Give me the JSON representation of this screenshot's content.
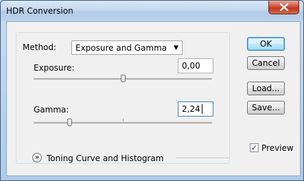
{
  "window": {
    "title": "HDR Conversion"
  },
  "method": {
    "label": "Method:",
    "value": "Exposure and Gamma"
  },
  "exposure": {
    "label": "Exposure:",
    "value": "0,00",
    "slider_fraction": 0.5
  },
  "gamma": {
    "label": "Gamma:",
    "value": "2,24",
    "slider_fraction": 0.2
  },
  "toning": {
    "label": "Toning Curve and Histogram"
  },
  "buttons": {
    "ok": "OK",
    "cancel": "Cancel",
    "load": "Load...",
    "save": "Save..."
  },
  "preview": {
    "label": "Preview",
    "checked": true
  }
}
